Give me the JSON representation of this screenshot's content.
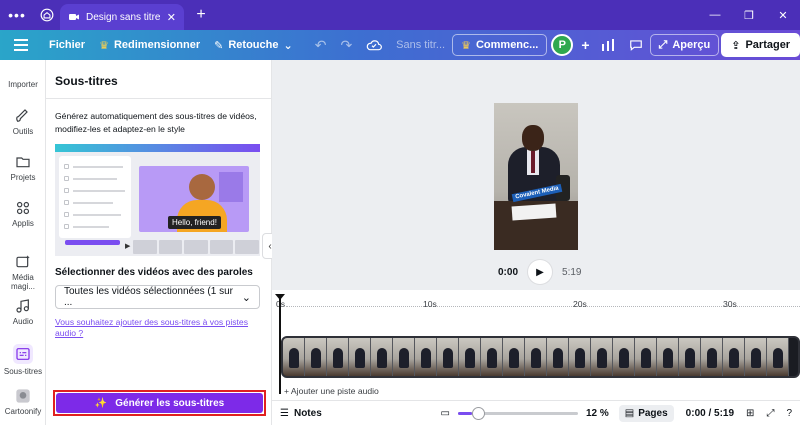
{
  "browser": {
    "menu": "•••",
    "tab_title": "Design sans titre - ...",
    "tab_close": "✕",
    "new_tab": "+",
    "window": {
      "minimize": "—",
      "restore": "❐",
      "close": "✕"
    }
  },
  "toolbar": {
    "file": "Fichier",
    "resize": "Redimensionner",
    "edit": "Retouche",
    "title": "Sans titr...",
    "upgrade": "Commenc...",
    "avatar": "P",
    "add": "+",
    "preview": "Aperçu",
    "share": "Partager"
  },
  "rail": {
    "items": [
      {
        "label": "Importer"
      },
      {
        "label": "Outils"
      },
      {
        "label": "Projets"
      },
      {
        "label": "Applis"
      },
      {
        "label": "Média magi..."
      },
      {
        "label": "Audio"
      },
      {
        "label": "Sous-titres"
      },
      {
        "label": "Cartoonify"
      }
    ]
  },
  "panel": {
    "title": "Sous-titres",
    "description": "Générez automatiquement des sous-titres de vidéos, modifiez-les et adaptez-en le style",
    "illustration_caption": "Hello, friend!",
    "select_label": "Sélectionner des vidéos avec des paroles",
    "select_value": "Toutes les vidéos sélectionnées (1 sur ...",
    "link": "Vous souhaitez ajouter des sous-titres à vos pistes audio ?",
    "generate_button": "Générer les sous-titres"
  },
  "canvas": {
    "frame_tag": "Covalent Media",
    "current_time": "0:00",
    "duration": "5:19"
  },
  "timeline": {
    "ticks": [
      "0s",
      "10s",
      "20s",
      "30s"
    ],
    "add_audio": "+ Ajouter une piste audio"
  },
  "bottombar": {
    "notes": "Notes",
    "zoom": "12 %",
    "zoom_fraction": 0.12,
    "pages": "Pages",
    "time": "0:00 / 5:19"
  },
  "colors": {
    "accent": "#7d2ae8",
    "highlight_border": "#e02020",
    "tabbar": "#4b2fb8"
  }
}
